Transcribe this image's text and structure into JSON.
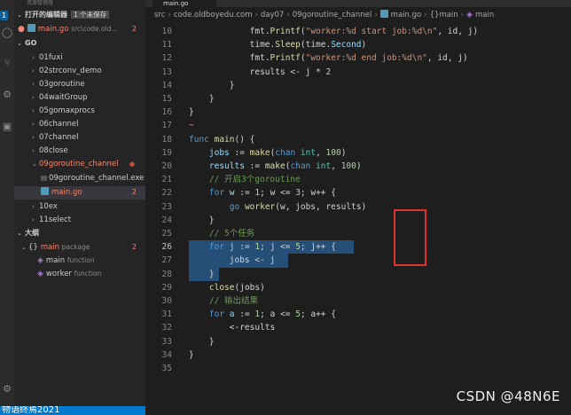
{
  "sidebar": {
    "title": "资源管理器",
    "open_editors": {
      "label": "打开的编辑器",
      "unsaved": "1 个未保存"
    },
    "open_file": {
      "name": "main.go",
      "path": "src\\code.old...",
      "count": "2"
    },
    "project": {
      "label": "GO"
    },
    "folders": [
      {
        "label": "01fuxi"
      },
      {
        "label": "02strconv_demo"
      },
      {
        "label": "03goroutine"
      },
      {
        "label": "04waitGroup"
      },
      {
        "label": "05gomaxprocs"
      },
      {
        "label": "06channel"
      },
      {
        "label": "07channel"
      },
      {
        "label": "08close"
      },
      {
        "label": "09goroutine_channel"
      },
      {
        "label": "09goroutine_channel.exe"
      },
      {
        "label": "main.go",
        "count": "2"
      },
      {
        "label": "10ex"
      },
      {
        "label": "11select"
      }
    ],
    "outline": {
      "label": "大纲",
      "items": [
        {
          "name": "main",
          "kind": "package",
          "count": "2"
        },
        {
          "name": "main",
          "kind": "function"
        },
        {
          "name": "worker",
          "kind": "function"
        }
      ]
    }
  },
  "tab": {
    "label": "main.go"
  },
  "breadcrumb": [
    "src",
    "code.oldboyedu.com",
    "day07",
    "09goroutine_channel",
    "main.go",
    "{}main",
    "main"
  ],
  "code": {
    "lines": [
      {
        "n": "10",
        "tokens": [
          [
            "            ",
            "p"
          ],
          [
            "fmt",
            "p"
          ],
          [
            ".",
            "p"
          ],
          [
            "Printf",
            "f"
          ],
          [
            "(",
            "p"
          ],
          [
            "\"worker:%d start job:%d\\n\"",
            "s"
          ],
          [
            ", id, j)",
            "p"
          ]
        ]
      },
      {
        "n": "11",
        "tokens": [
          [
            "            ",
            "p"
          ],
          [
            "time",
            "p"
          ],
          [
            ".",
            "p"
          ],
          [
            "Sleep",
            "f"
          ],
          [
            "(time.",
            "p"
          ],
          [
            "Second",
            "v"
          ],
          [
            ")",
            "p"
          ]
        ]
      },
      {
        "n": "12",
        "tokens": [
          [
            "            ",
            "p"
          ],
          [
            "fmt",
            "p"
          ],
          [
            ".",
            "p"
          ],
          [
            "Printf",
            "f"
          ],
          [
            "(",
            "p"
          ],
          [
            "\"worker:%d end job:%d\\n\"",
            "s"
          ],
          [
            ", id, j)",
            "p"
          ]
        ]
      },
      {
        "n": "13",
        "tokens": [
          [
            "            ",
            "p"
          ],
          [
            "results <- j * ",
            "p"
          ],
          [
            "2",
            "n"
          ]
        ]
      },
      {
        "n": "14",
        "tokens": [
          [
            "        }",
            "p"
          ]
        ]
      },
      {
        "n": "15",
        "tokens": [
          [
            "    }",
            "p"
          ]
        ]
      },
      {
        "n": "16",
        "tokens": [
          [
            "}",
            "p"
          ]
        ]
      },
      {
        "n": "17",
        "tokens": [
          [
            "~",
            "s"
          ]
        ]
      },
      {
        "n": "18",
        "tokens": [
          [
            "func ",
            "k"
          ],
          [
            "main",
            "f"
          ],
          [
            "() {",
            "p"
          ]
        ]
      },
      {
        "n": "19",
        "tokens": [
          [
            "    ",
            "p"
          ],
          [
            "jobs",
            "v"
          ],
          [
            " := ",
            "p"
          ],
          [
            "make",
            "f"
          ],
          [
            "(",
            "p"
          ],
          [
            "chan ",
            "k"
          ],
          [
            "int",
            "t"
          ],
          [
            ", ",
            "p"
          ],
          [
            "100",
            "n"
          ],
          [
            ")",
            "p"
          ]
        ]
      },
      {
        "n": "20",
        "tokens": [
          [
            "    ",
            "p"
          ],
          [
            "results",
            "v"
          ],
          [
            " := ",
            "p"
          ],
          [
            "make",
            "f"
          ],
          [
            "(",
            "p"
          ],
          [
            "chan ",
            "k"
          ],
          [
            "int",
            "t"
          ],
          [
            ", ",
            "p"
          ],
          [
            "100",
            "n"
          ],
          [
            ")",
            "p"
          ]
        ]
      },
      {
        "n": "21",
        "tokens": [
          [
            "    ",
            "p"
          ],
          [
            "// 开启3个goroutine",
            "c"
          ]
        ]
      },
      {
        "n": "22",
        "tokens": [
          [
            "    ",
            "p"
          ],
          [
            "for ",
            "k"
          ],
          [
            "w",
            "v"
          ],
          [
            " := ",
            "p"
          ],
          [
            "1",
            "n"
          ],
          [
            "; w <= ",
            "p"
          ],
          [
            "3",
            "n"
          ],
          [
            "; w++ {",
            "p"
          ]
        ]
      },
      {
        "n": "23",
        "tokens": [
          [
            "        ",
            "p"
          ],
          [
            "go ",
            "k"
          ],
          [
            "worker",
            "f"
          ],
          [
            "(w, jobs, results)",
            "p"
          ]
        ]
      },
      {
        "n": "24",
        "tokens": [
          [
            "    }",
            "p"
          ]
        ]
      },
      {
        "n": "25",
        "tokens": [
          [
            "    ",
            "p"
          ],
          [
            "// 5个任务",
            "c"
          ]
        ]
      },
      {
        "n": "26",
        "tokens": [
          [
            "    ",
            "p"
          ],
          [
            "for ",
            "k"
          ],
          [
            "j",
            "v"
          ],
          [
            " := ",
            "p"
          ],
          [
            "1",
            "n"
          ],
          [
            "; j <= ",
            "p"
          ],
          [
            "5",
            "n"
          ],
          [
            "; j++ {",
            "p"
          ]
        ]
      },
      {
        "n": "27",
        "tokens": [
          [
            "        ",
            "p"
          ],
          [
            "jobs <- j",
            "p"
          ]
        ]
      },
      {
        "n": "28",
        "tokens": [
          [
            "    }",
            "p"
          ]
        ]
      },
      {
        "n": "29",
        "tokens": [
          [
            "    ",
            "p"
          ],
          [
            "close",
            "f"
          ],
          [
            "(jobs)",
            "p"
          ]
        ]
      },
      {
        "n": "30",
        "tokens": [
          [
            "    ",
            "p"
          ],
          [
            "// 输出结果",
            "c"
          ]
        ]
      },
      {
        "n": "31",
        "tokens": [
          [
            "    ",
            "p"
          ],
          [
            "for ",
            "k"
          ],
          [
            "a",
            "v"
          ],
          [
            " := ",
            "p"
          ],
          [
            "1",
            "n"
          ],
          [
            "; a <= ",
            "p"
          ],
          [
            "5",
            "n"
          ],
          [
            "; a++ {",
            "p"
          ]
        ]
      },
      {
        "n": "32",
        "tokens": [
          [
            "        ",
            "p"
          ],
          [
            "<-results",
            "p"
          ]
        ]
      },
      {
        "n": "33",
        "tokens": [
          [
            "    }",
            "p"
          ]
        ]
      },
      {
        "n": "34",
        "tokens": [
          [
            "}",
            "p"
          ]
        ]
      },
      {
        "n": "35",
        "tokens": []
      }
    ]
  },
  "watermark": "CSDN @48N6E",
  "bottom_text": "物语终焉2021"
}
